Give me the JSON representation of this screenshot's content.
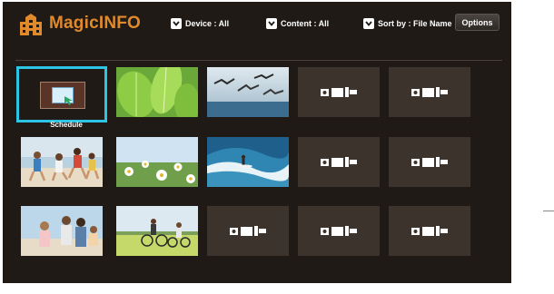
{
  "header": {
    "app_title": "MagicINFO",
    "filters": {
      "device": "Device : All",
      "content": "Content : All",
      "sort": "Sort by : File Name"
    },
    "options_label": "Options"
  },
  "grid": {
    "selected_label": "Schedule",
    "tiles": [
      {
        "kind": "schedule",
        "label": "Schedule",
        "selected": true
      },
      {
        "kind": "photo",
        "subject": "green-leaves"
      },
      {
        "kind": "photo",
        "subject": "seagulls-over-sea"
      },
      {
        "kind": "placeholder"
      },
      {
        "kind": "placeholder"
      },
      {
        "kind": "photo",
        "subject": "kids-running-beach"
      },
      {
        "kind": "photo",
        "subject": "flower-field"
      },
      {
        "kind": "photo",
        "subject": "surfer-wave"
      },
      {
        "kind": "placeholder"
      },
      {
        "kind": "placeholder"
      },
      {
        "kind": "photo",
        "subject": "family-photo"
      },
      {
        "kind": "photo",
        "subject": "cyclists-field"
      },
      {
        "kind": "placeholder"
      },
      {
        "kind": "placeholder"
      },
      {
        "kind": "placeholder"
      }
    ]
  },
  "icons": {
    "logo": "magicinfo-logo-icon",
    "chevron": "chevron-down-icon",
    "placeholder": "media-placeholder-icon"
  },
  "colors": {
    "background": "#1f1a16",
    "brand": "#e08a2c",
    "selection": "#2ec4e6",
    "tile": "#3b332c"
  }
}
